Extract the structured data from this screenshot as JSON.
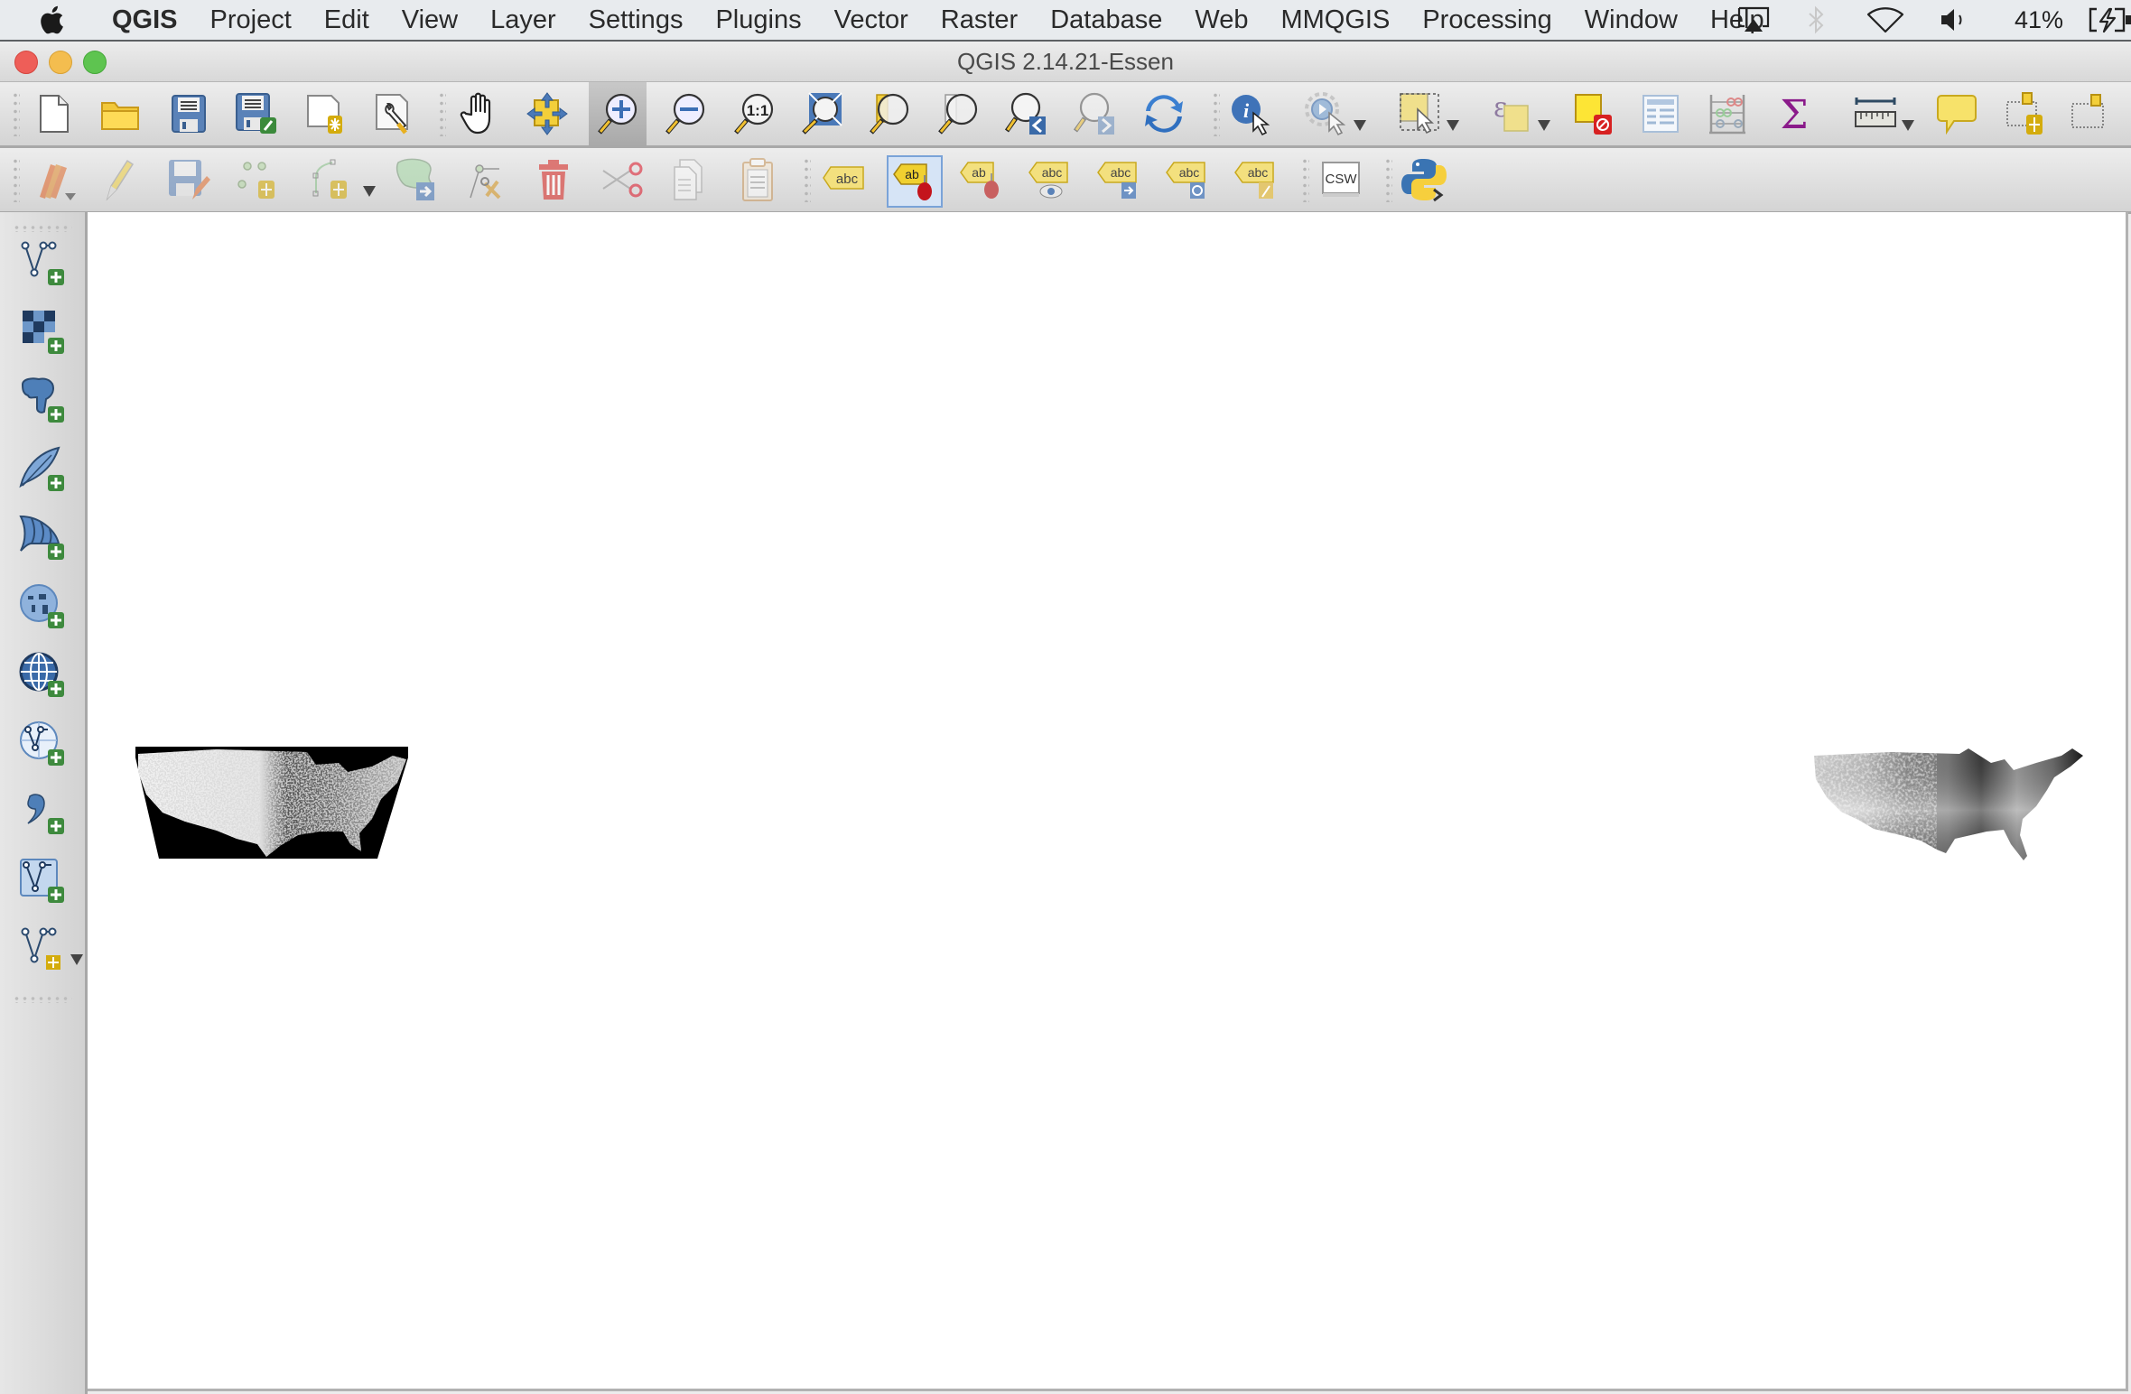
{
  "menubar": {
    "apple_icon": "apple-logo-icon",
    "items": [
      "QGIS",
      "Project",
      "Edit",
      "View",
      "Layer",
      "Settings",
      "Plugins",
      "Vector",
      "Raster",
      "Database",
      "Web",
      "MMQGIS",
      "Processing",
      "Window",
      "Help"
    ],
    "status": {
      "icons": [
        "airplay-icon",
        "bluetooth-icon",
        "wifi-icon",
        "volume-icon"
      ],
      "battery_percent": "41%",
      "battery_icon": "battery-charging-icon"
    }
  },
  "window": {
    "title": "QGIS 2.14.21-Essen",
    "buttons": [
      "close",
      "minimize",
      "zoom"
    ],
    "colors": {
      "close": "#ee5e58",
      "minimize": "#f4bd4f",
      "zoom": "#5ec450"
    }
  },
  "toolbar_file_nav": {
    "buttons": [
      {
        "name": "new-project",
        "tooltip": "New Project"
      },
      {
        "name": "open-project",
        "tooltip": "Open Project"
      },
      {
        "name": "save-project",
        "tooltip": "Save Project"
      },
      {
        "name": "save-project-as",
        "tooltip": "Save Project As"
      },
      {
        "name": "new-print-composer",
        "tooltip": "New Print Composer"
      },
      {
        "name": "composer-manager",
        "tooltip": "Composer Manager"
      },
      {
        "name": "pan-map",
        "tooltip": "Pan Map"
      },
      {
        "name": "pan-to-selection",
        "tooltip": "Pan Map to Selection"
      },
      {
        "name": "zoom-in",
        "tooltip": "Zoom In",
        "active": true
      },
      {
        "name": "zoom-out",
        "tooltip": "Zoom Out"
      },
      {
        "name": "zoom-native",
        "tooltip": "Zoom to Native Resolution",
        "label": "1:1"
      },
      {
        "name": "zoom-full",
        "tooltip": "Zoom Full"
      },
      {
        "name": "zoom-to-selection",
        "tooltip": "Zoom to Selection"
      },
      {
        "name": "zoom-to-layer",
        "tooltip": "Zoom to Layer"
      },
      {
        "name": "zoom-last",
        "tooltip": "Zoom Last"
      },
      {
        "name": "zoom-next",
        "tooltip": "Zoom Next"
      },
      {
        "name": "refresh",
        "tooltip": "Refresh"
      },
      {
        "name": "identify-features",
        "tooltip": "Identify Features"
      },
      {
        "name": "run-feature-action",
        "tooltip": "Run Feature Action"
      },
      {
        "name": "select-features",
        "tooltip": "Select Features"
      },
      {
        "name": "select-by-expression",
        "tooltip": "Select by Expression"
      },
      {
        "name": "deselect-all",
        "tooltip": "Deselect Features"
      },
      {
        "name": "open-attribute-table",
        "tooltip": "Open Attribute Table"
      },
      {
        "name": "open-field-calculator",
        "tooltip": "Open Field Calculator"
      },
      {
        "name": "show-statistical-summary",
        "tooltip": "Show Statistical Summary",
        "label": "Σ"
      },
      {
        "name": "measure-line",
        "tooltip": "Measure Line"
      },
      {
        "name": "map-tips",
        "tooltip": "Show Map Tips"
      },
      {
        "name": "new-bookmark",
        "tooltip": "New Bookmark"
      },
      {
        "name": "show-bookmarks",
        "tooltip": "Show Bookmarks"
      }
    ]
  },
  "toolbar_edit_label": {
    "buttons": [
      {
        "name": "current-edits",
        "tooltip": "Current Edits"
      },
      {
        "name": "toggle-editing",
        "tooltip": "Toggle Editing"
      },
      {
        "name": "save-layer-edits",
        "tooltip": "Save Layer Edits"
      },
      {
        "name": "add-feature",
        "tooltip": "Add Feature"
      },
      {
        "name": "add-circular-string",
        "tooltip": "Add Circular String"
      },
      {
        "name": "move-feature",
        "tooltip": "Move Feature(s)"
      },
      {
        "name": "node-tool",
        "tooltip": "Node Tool"
      },
      {
        "name": "delete-selected",
        "tooltip": "Delete Selected"
      },
      {
        "name": "cut-features",
        "tooltip": "Cut Features"
      },
      {
        "name": "copy-features",
        "tooltip": "Copy Features"
      },
      {
        "name": "paste-features",
        "tooltip": "Paste Features"
      },
      {
        "name": "layer-labeling-options",
        "tooltip": "Layer Labeling Options",
        "label": "abc"
      },
      {
        "name": "highlight-pinned-labels",
        "tooltip": "Highlight Pinned Labels",
        "label": "ab"
      },
      {
        "name": "pin-unpin-labels",
        "tooltip": "Pin/Unpin Labels",
        "label": "ab"
      },
      {
        "name": "show-hide-labels",
        "tooltip": "Show/Hide Labels",
        "label": "abc"
      },
      {
        "name": "move-label",
        "tooltip": "Move Label",
        "label": "abc"
      },
      {
        "name": "rotate-label",
        "tooltip": "Rotate Label",
        "label": "abc"
      },
      {
        "name": "change-label",
        "tooltip": "Change Label",
        "label": "abc"
      },
      {
        "name": "metasearch",
        "tooltip": "MetaSearch",
        "label": "CSW"
      },
      {
        "name": "python-console",
        "tooltip": "Python Console"
      }
    ]
  },
  "toolbar_manage_layers": {
    "buttons": [
      {
        "name": "add-vector-layer",
        "tooltip": "Add Vector Layer"
      },
      {
        "name": "add-raster-layer",
        "tooltip": "Add Raster Layer"
      },
      {
        "name": "add-postgis-layer",
        "tooltip": "Add PostGIS Layers"
      },
      {
        "name": "add-spatialite-layer",
        "tooltip": "Add SpatiaLite Layer"
      },
      {
        "name": "add-mssql-layer",
        "tooltip": "Add MSSQL Spatial Layer"
      },
      {
        "name": "add-wms-layer",
        "tooltip": "Add WMS/WMTS Layer"
      },
      {
        "name": "add-wcs-layer",
        "tooltip": "Add WCS Layer"
      },
      {
        "name": "add-wfs-layer",
        "tooltip": "Add WFS Layer"
      },
      {
        "name": "add-delimited-text-layer",
        "tooltip": "Add Delimited Text Layer"
      },
      {
        "name": "add-virtual-layer",
        "tooltip": "Add Virtual Layer"
      },
      {
        "name": "new-shapefile-layer",
        "tooltip": "New Shapefile Layer"
      }
    ]
  },
  "map_canvas": {
    "layers": [
      {
        "name": "us-raster-binned",
        "description": "Continental US raster, black background with grayscale speckled values"
      },
      {
        "name": "us-raster-gradient",
        "description": "Continental US raster, smooth grayscale gradient, no-data transparent"
      }
    ]
  }
}
